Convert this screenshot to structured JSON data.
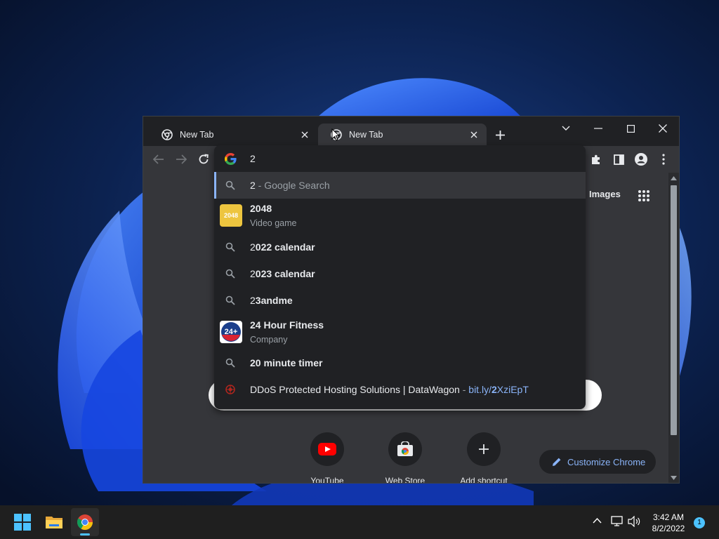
{
  "tabs": [
    {
      "title": "New Tab",
      "active": false
    },
    {
      "title": "New Tab",
      "active": true
    }
  ],
  "content": {
    "images_link": "Images",
    "shortcuts": [
      {
        "label": "YouTube",
        "icon": "youtube-icon"
      },
      {
        "label": "Web Store",
        "icon": "web-store-icon"
      },
      {
        "label": "Add shortcut",
        "icon": "plus-icon"
      }
    ],
    "customize_label": "Customize Chrome"
  },
  "omnibox": {
    "input_value": "2",
    "suggestions": [
      {
        "type": "search",
        "bold": "2",
        "rest": "",
        "suffix": " - Google Search",
        "selected": true
      },
      {
        "type": "entity",
        "bold": "2048",
        "subtitle": "Video game",
        "thumb": "2048"
      },
      {
        "type": "search",
        "bold": "2",
        "rest": "022 calendar"
      },
      {
        "type": "search",
        "bold": "2",
        "rest": "023 calendar"
      },
      {
        "type": "search",
        "bold": "2",
        "rest": "3andme"
      },
      {
        "type": "entity",
        "bold": "24 Hour Fitness",
        "subtitle": "Company",
        "thumb": "24+"
      },
      {
        "type": "search",
        "bold": "2",
        "rest": "0 minute timer"
      },
      {
        "type": "history",
        "title": "DDoS Protected Hosting Solutions | DataWagon",
        "sep": " - ",
        "url_pre": "bit.ly/",
        "url_bold": "2",
        "url_post": "XziEpT"
      }
    ]
  },
  "taskbar": {
    "time": "3:42 AM",
    "date": "8/2/2022",
    "notification_count": "1"
  },
  "colors": {
    "accent": "#8ab4f8",
    "window_bg": "#35363a",
    "frame_bg": "#202124",
    "wallpaper_blue": "#1a5cff"
  }
}
